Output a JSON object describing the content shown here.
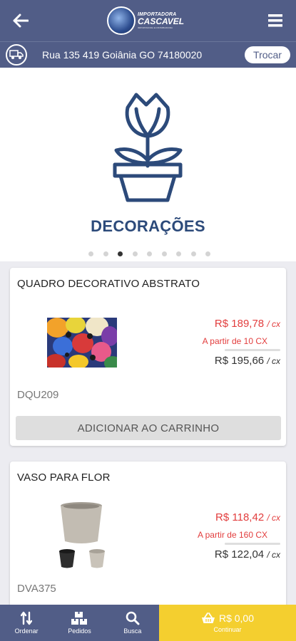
{
  "header": {
    "logo_line1": "IMPORTADORA",
    "logo_line2": "CASCAVEL",
    "logo_line3": "IMPORTADORA E DISTRIBUIDORA"
  },
  "address": {
    "text": "Rua 135 419 Goiânia GO 74180020",
    "change_label": "Trocar"
  },
  "banner": {
    "title": "DECORAÇÕES",
    "dot_count": 9,
    "active_dot": 2
  },
  "products": [
    {
      "name": "QUADRO DECORATIVO ABSTRATO",
      "price_promo": "R$ 189,78",
      "unit": "/ cx",
      "min_qty": "A partir de 10 CX",
      "price_regular": "R$ 195,66",
      "sku": "DQU209",
      "add_label": "ADICIONAR AO CARRINHO"
    },
    {
      "name": "VASO PARA FLOR",
      "price_promo": "R$ 118,42",
      "unit": "/ cx",
      "min_qty": "A partir de 160 CX",
      "price_regular": "R$ 122,04",
      "sku": "DVA375"
    }
  ],
  "nav": {
    "order_label": "Ordenar",
    "orders_label": "Pedidos",
    "search_label": "Busca",
    "cart_total": "R$ 0,00",
    "cart_sub": "Continuar"
  },
  "colors": {
    "header": "#515d87",
    "accent_red": "#e23d3d",
    "cart_yellow": "#f4cf2f",
    "banner_title": "#2c4a7a"
  }
}
